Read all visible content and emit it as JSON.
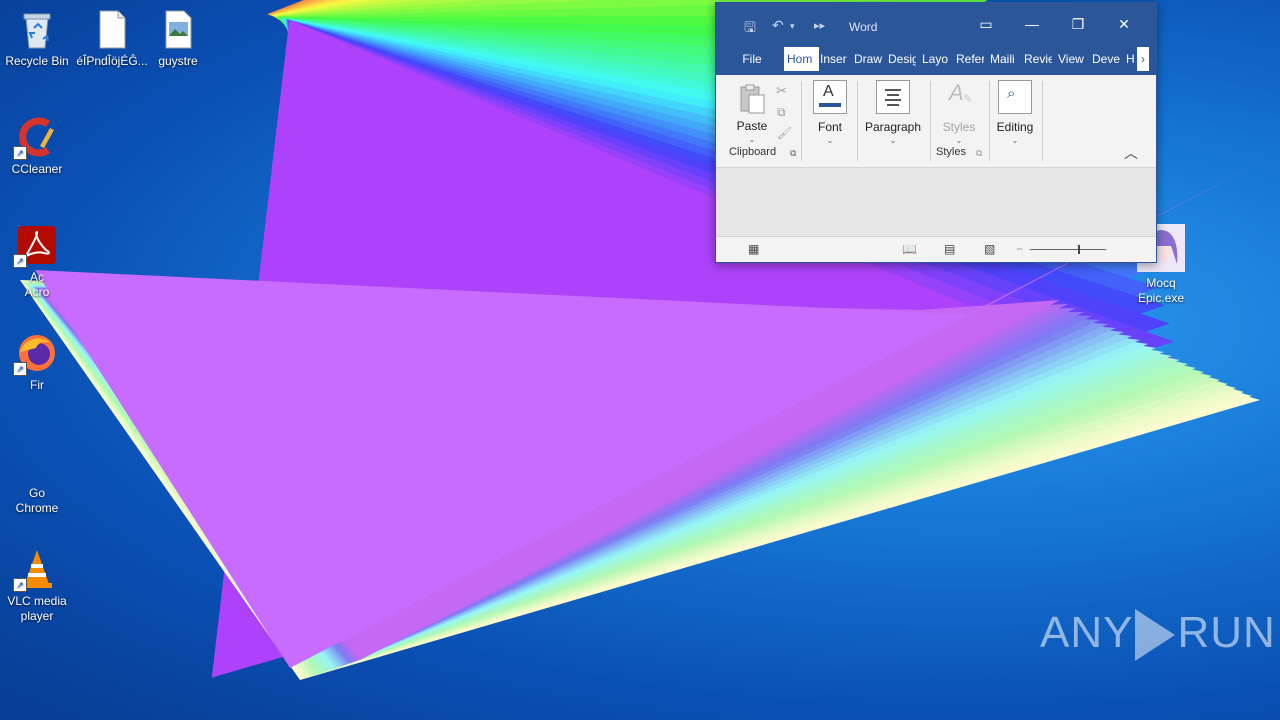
{
  "desktop": {
    "icons": [
      {
        "name": "recycle-bin",
        "label": "Recycle Bin"
      },
      {
        "name": "file-1",
        "label": "éÎPndÎöjÉĜ..."
      },
      {
        "name": "file-2",
        "label": "guystre"
      },
      {
        "name": "ccleaner",
        "label": "CCleaner"
      },
      {
        "name": "acrobat",
        "label": "Ac\nAcro"
      },
      {
        "name": "firefox",
        "label": "Fir"
      },
      {
        "name": "chrome",
        "label": "Go\nChrome"
      },
      {
        "name": "vlc",
        "label": "VLC media\nplayer"
      },
      {
        "name": "mocq",
        "label": "Mocq\nEpic.exe"
      }
    ]
  },
  "word": {
    "title": "Word",
    "tabs": [
      "File",
      "Hom",
      "Inser",
      "Draw",
      "Desig",
      "Layo",
      "Refer",
      "Maili",
      "Revie",
      "View",
      "Deve",
      "H"
    ],
    "active_tab": "Hom",
    "ribbon": {
      "paste_label": "Paste",
      "font_label": "Font",
      "paragraph_label": "Paragraph",
      "styles_label": "Styles",
      "editing_label": "Editing",
      "clipboard_group": "Clipboard",
      "styles_group": "Styles"
    }
  },
  "watermark": {
    "left": "ANY",
    "right": "RUN"
  },
  "colors": {
    "word_blue": "#2b579a",
    "desktop_blue": "#1677d6"
  }
}
